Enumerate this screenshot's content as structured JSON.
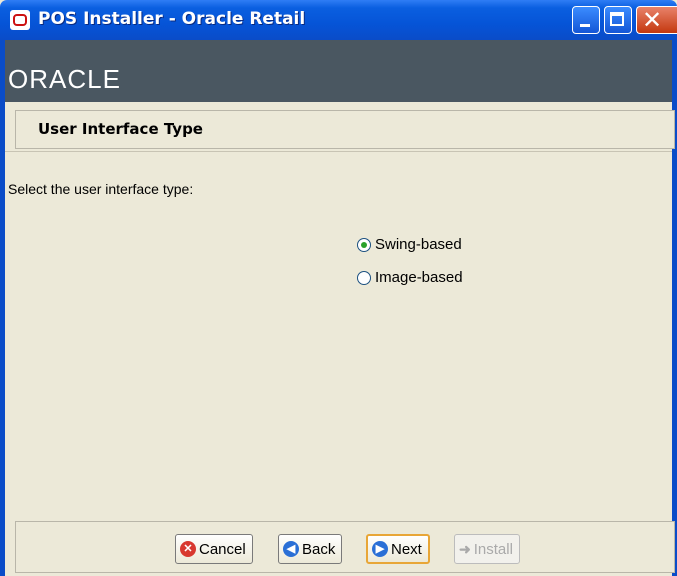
{
  "window": {
    "title": "POS Installer - Oracle Retail",
    "brand": "ORACLE"
  },
  "header": {
    "title": "User Interface Type"
  },
  "main": {
    "prompt": "Select the user interface type:",
    "options": [
      {
        "label": "Swing-based",
        "checked": true
      },
      {
        "label": "Image-based",
        "checked": false
      }
    ]
  },
  "buttons": {
    "cancel": "Cancel",
    "back": "Back",
    "next": "Next",
    "install": "Install"
  },
  "colors": {
    "titlebar": "#0654d7",
    "oracle_bar": "#4a5761",
    "panel": "#ece9d8"
  },
  "icons": {
    "app": "oracle-app-icon",
    "cancel": "x-circle-icon",
    "back": "left-arrow-circle-icon",
    "next": "right-arrow-circle-icon",
    "install": "install-arrow-icon"
  }
}
